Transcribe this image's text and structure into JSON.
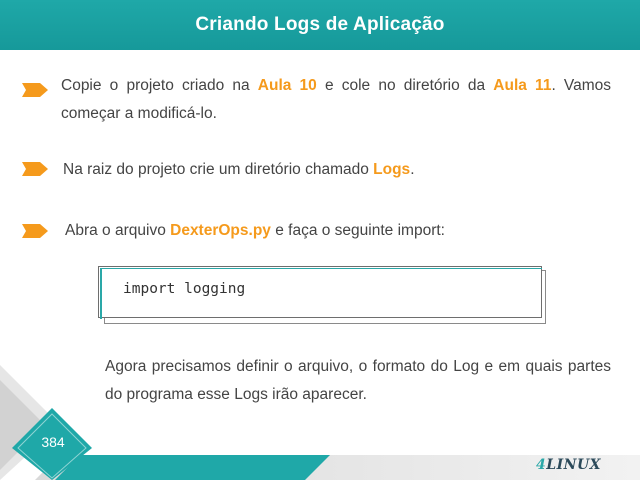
{
  "slide": {
    "title": "Criando Logs de Aplicação",
    "page_number": "384",
    "logo": {
      "prefix": "4",
      "text": "LINUX"
    }
  },
  "bullets": [
    {
      "icon": "orange-arrow-icon",
      "parts": [
        {
          "t": "Copie o projeto criado na ",
          "hl": false
        },
        {
          "t": "Aula 10",
          "hl": true
        },
        {
          "t": " e cole no diretório da ",
          "hl": false
        },
        {
          "t": "Aula 11",
          "hl": true
        },
        {
          "t": ". Vamos começar a modificá-lo.",
          "hl": false
        }
      ]
    },
    {
      "icon": "orange-arrow-icon",
      "parts": [
        {
          "t": "Na raiz do projeto crie um diretório chamado ",
          "hl": false
        },
        {
          "t": "Logs",
          "hl": true
        },
        {
          "t": ".",
          "hl": false
        }
      ]
    },
    {
      "icon": "orange-arrow-icon",
      "parts": [
        {
          "t": "Abra o arquivo ",
          "hl": false
        },
        {
          "t": "DexterOps.py",
          "hl": true
        },
        {
          "t": " e faça o seguinte import:",
          "hl": false
        }
      ]
    }
  ],
  "code": "import logging",
  "paragraph": "Agora precisamos definir o arquivo, o formato do Log e em quais partes do programa esse Logs irão aparecer.",
  "colors": {
    "header": "#1fa8a8",
    "highlight": "#f59a1c",
    "arrow": "#f59a1c",
    "footer_teal": "#1fa8a8"
  }
}
